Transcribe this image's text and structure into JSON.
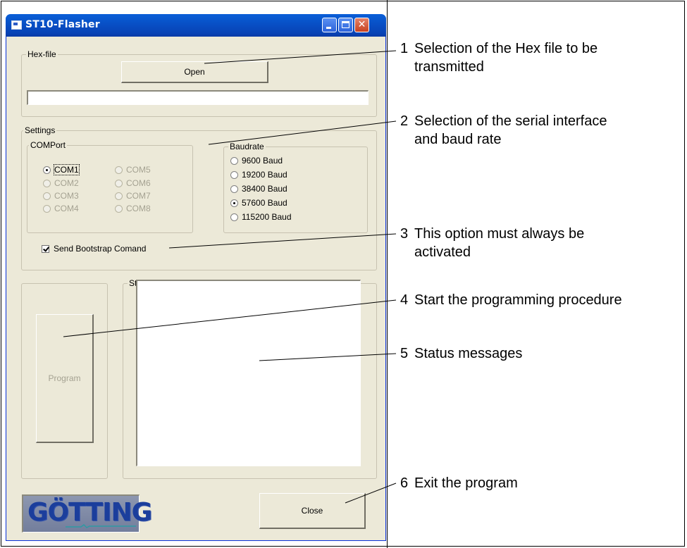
{
  "window": {
    "title": "ST10-Flasher",
    "buttons": [
      "minimize",
      "maximize",
      "close"
    ]
  },
  "hexfile": {
    "legend": "Hex-file",
    "open_label": "Open",
    "path_value": ""
  },
  "settings": {
    "legend": "Settings",
    "comport": {
      "legend": "COMPort",
      "options": [
        "COM1",
        "COM2",
        "COM3",
        "COM4",
        "COM5",
        "COM6",
        "COM7",
        "COM8"
      ],
      "selected": "COM1"
    },
    "baudrate": {
      "legend": "Baudrate",
      "options": [
        "9600 Baud",
        "19200 Baud",
        "38400 Baud",
        "57600 Baud",
        "115200 Baud"
      ],
      "selected": "57600 Baud"
    },
    "bootstrap_label": "Send Bootstrap Comand",
    "bootstrap_checked": true
  },
  "program": {
    "label": "Program"
  },
  "status": {
    "legend": "Status",
    "text": ""
  },
  "close_label": "Close",
  "logo_text": "GÖTTING",
  "annotations": [
    {
      "num": "1",
      "line1": "Selection of the Hex file to be",
      "line2": "transmitted"
    },
    {
      "num": "2",
      "line1": "Selection of the serial interface",
      "line2": "and baud rate"
    },
    {
      "num": "3",
      "line1": "This option must always be",
      "line2": "activated"
    },
    {
      "num": "4",
      "line1": "Start the programming procedure",
      "line2": ""
    },
    {
      "num": "5",
      "line1": "Status messages",
      "line2": ""
    },
    {
      "num": "6",
      "line1": "Exit the program",
      "line2": ""
    }
  ],
  "colors": {
    "titlebar": "#0851c7",
    "window_bg": "#ece9d8",
    "close_button": "#c8421f"
  }
}
